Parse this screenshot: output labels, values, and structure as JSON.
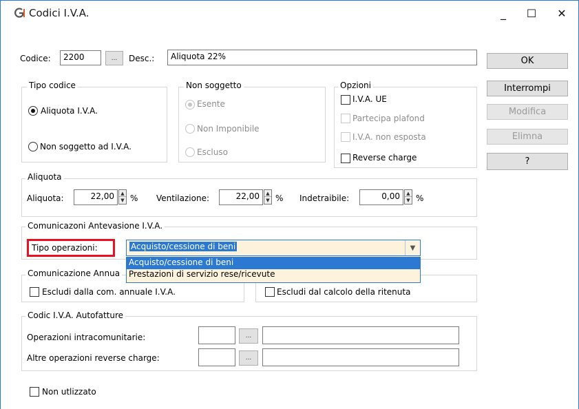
{
  "window": {
    "title": "Codici I.V.A.",
    "minimize": "_",
    "maximize": "☐",
    "close": "✕"
  },
  "header": {
    "codice_label": "Codice:",
    "codice_value": "2200",
    "browse_button": "...",
    "desc_label": "Desc.:",
    "desc_value": "Aliquota 22%"
  },
  "buttons": {
    "ok": "OK",
    "interrompi": "Interrompi",
    "modifica": "Modifica",
    "elimina": "Elimna",
    "help": "?"
  },
  "tipo_codice": {
    "title": "Tipo codice",
    "aliquota": "Aliquota I.V.A.",
    "non_soggetto": "Non soggetto ad I.V.A."
  },
  "non_soggetto": {
    "title": "Non soggetto",
    "esente": "Esente",
    "non_imponibile": "Non Imponibile",
    "escluso": "Escluso"
  },
  "opzioni": {
    "title": "Opzioni",
    "iva_ue": "I.V.A. UE",
    "partecipa_plafond": "Partecipa plafond",
    "iva_non_esposta": "I.V.A. non esposta",
    "reverse_charge": "Reverse charge"
  },
  "aliquota_group": {
    "title": "Aliquota",
    "aliquota_label": "Aliquota:",
    "aliquota_value": "22,00",
    "ventilazione_label": "Ventilazione:",
    "ventilazione_value": "22,00",
    "indetraibile_label": "Indetraibile:",
    "indetraibile_value": "0,00",
    "percent": "%"
  },
  "antievasione": {
    "title": "Comunicazoni Antevasione I.V.A.",
    "tipo_operazioni_label": "Tipo operazioni:",
    "selected": "Acquisto/cessione di beni",
    "options": [
      "Acquisto/cessione di beni",
      "Prestazioni di servizio rese/ricevute"
    ]
  },
  "com_annuale": {
    "title": "Comunicazione Annua",
    "escludi_annuale": "Escludi dalla com. annuale I.V.A.",
    "escludi_ritenuta": "Escludi dal calcolo della ritenuta"
  },
  "autofatture": {
    "title": "Codic I.V.A. Autofatture",
    "intracomunitarie": "Operazioni intracomunitarie:",
    "altre": "Altre operazioni reverse charge:"
  },
  "footer": {
    "non_utilizzato": "Non utlizzato"
  },
  "colors": {
    "highlight": "#e81123",
    "selection": "#2b79d0",
    "dropdown_bg": "#fdf3dc"
  }
}
